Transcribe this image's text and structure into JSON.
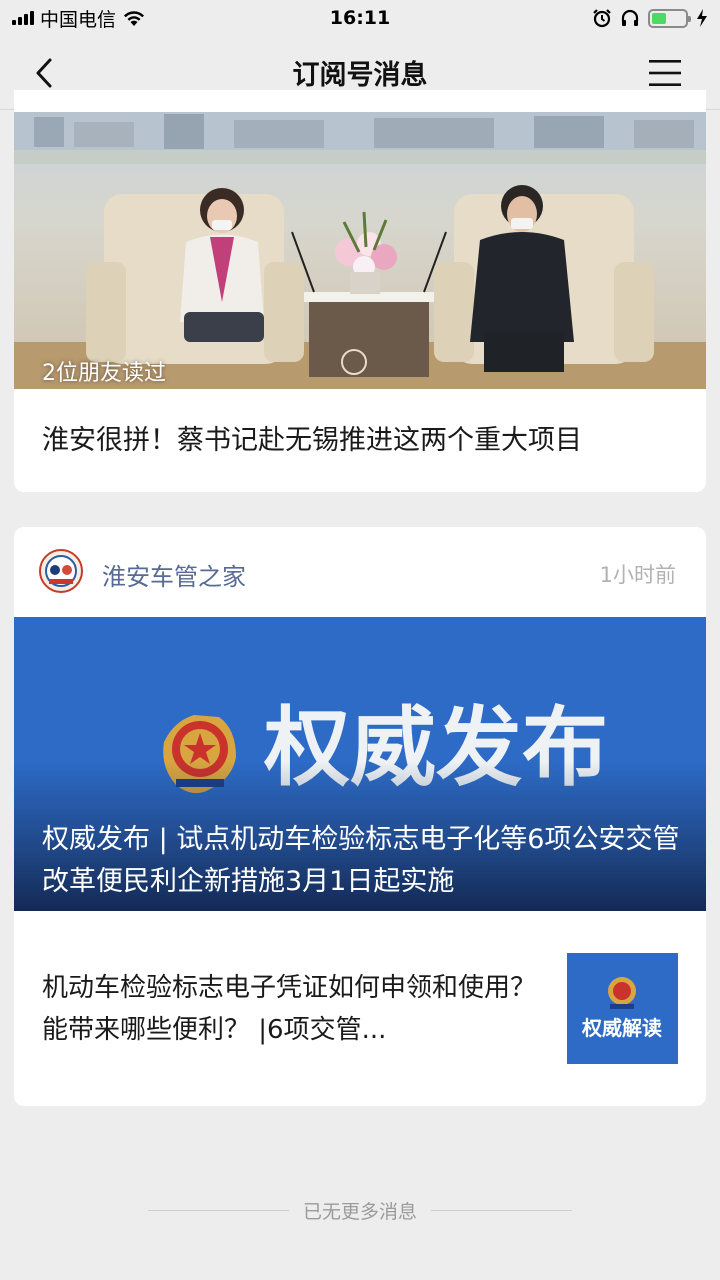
{
  "status_bar": {
    "carrier": "中国电信",
    "time": "16:11"
  },
  "nav": {
    "title": "订阅号消息"
  },
  "card1": {
    "friends_read": "2位朋友读过",
    "title": "淮安很拼！蔡书记赴无锡推进这两个重大项目"
  },
  "card2": {
    "account_name": "淮安车管之家",
    "time_ago": "1小时前",
    "banner_main_text": "权威发布",
    "headline": "权威发布 | 试点机动车检验标志电子化等6项公安交管改革便民利企新措施3月1日起实施",
    "sub_article_title": "机动车检验标志电子凭证如何申领和使用？能带来哪些便利？ |6项交管...",
    "sub_thumb_text": "权威解读"
  },
  "footer": {
    "end_text": "已无更多消息"
  },
  "colors": {
    "page_bg": "#ededed",
    "account_name": "#576b95",
    "banner_blue": "#2a68c4",
    "battery_green": "#4cd964"
  },
  "icons": [
    "signal-icon",
    "wifi-icon",
    "alarm-icon",
    "headphones-icon",
    "battery-icon",
    "charging-icon",
    "back-arrow-icon",
    "menu-icon",
    "police-badge-icon"
  ]
}
